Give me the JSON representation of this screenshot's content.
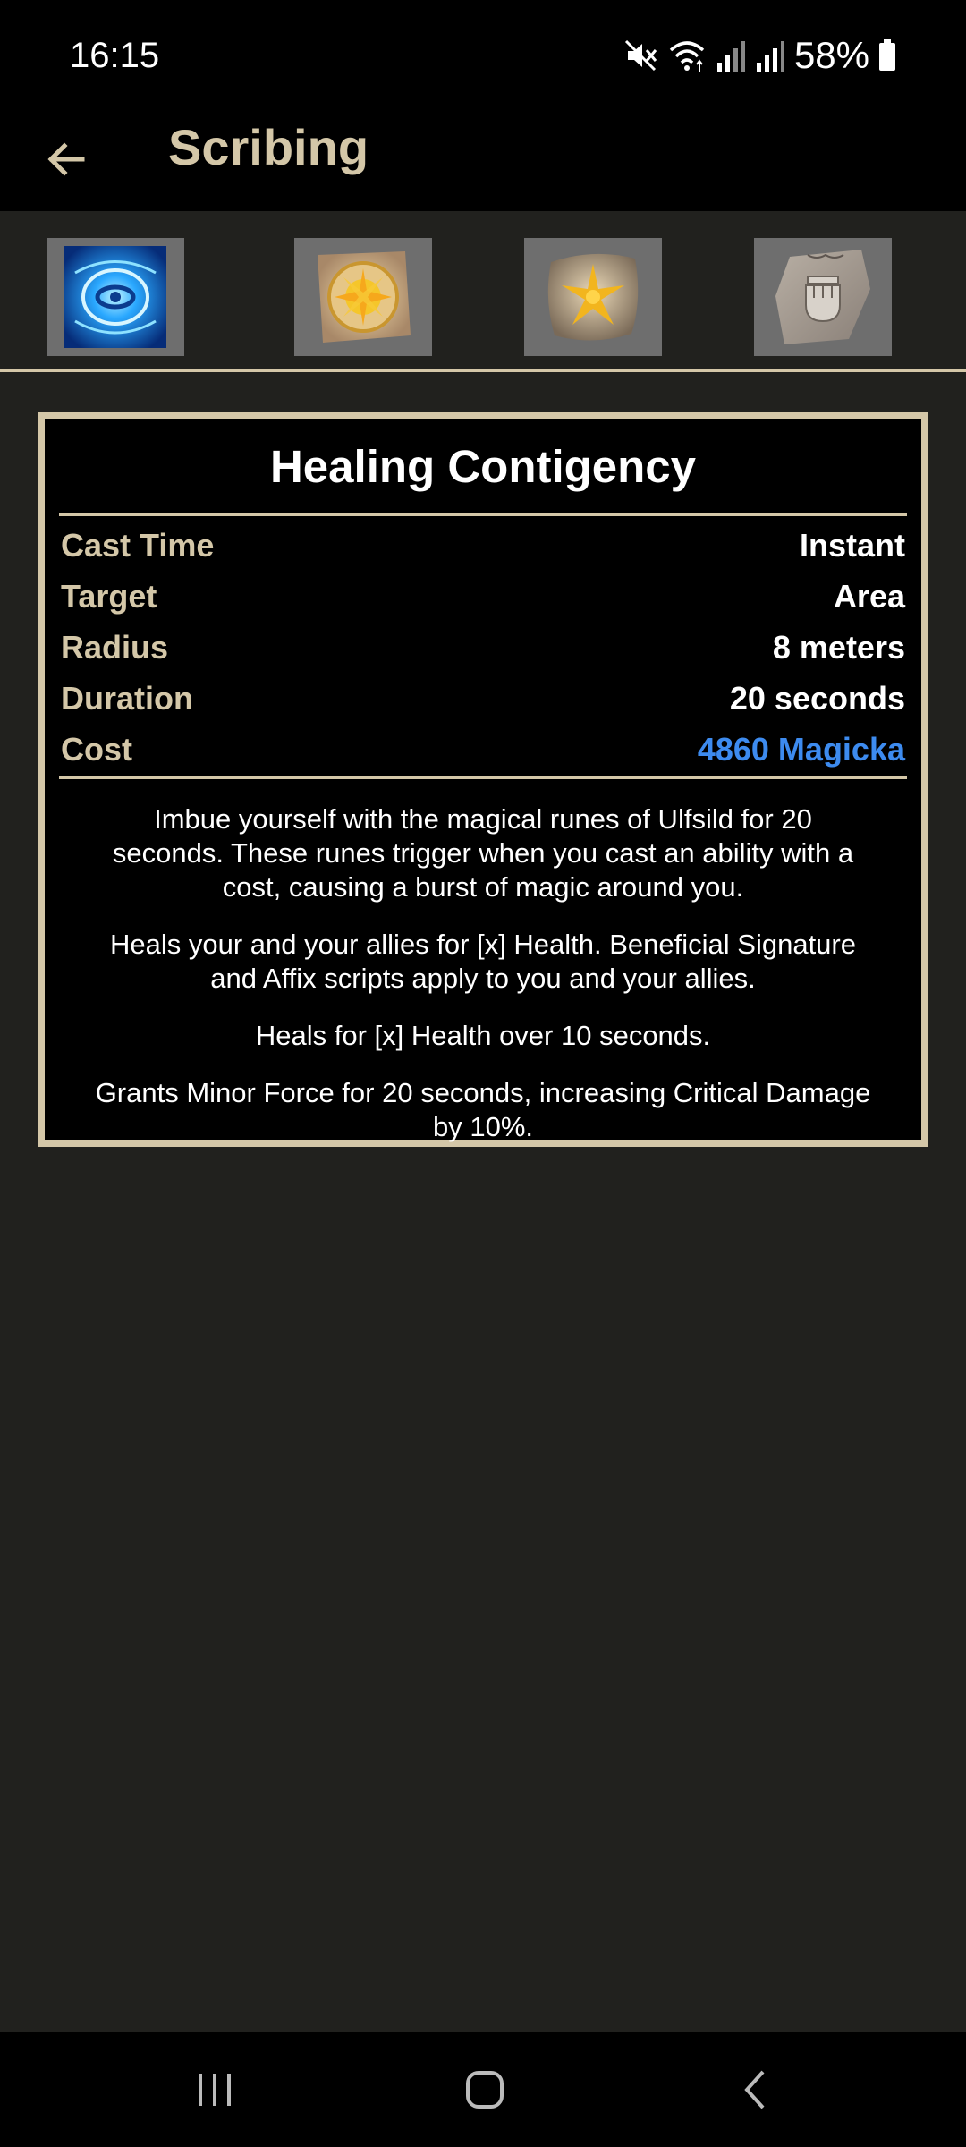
{
  "status": {
    "time": "16:15",
    "battery": "58%"
  },
  "appbar": {
    "title": "Scribing"
  },
  "tabs": [
    {
      "icon": "blue-magic-rune-icon"
    },
    {
      "icon": "sun-rune-stone-icon"
    },
    {
      "icon": "golden-star-stone-icon"
    },
    {
      "icon": "fist-stone-icon"
    }
  ],
  "card": {
    "title": "Healing Contigency",
    "stats": [
      {
        "label": "Cast Time",
        "value": "Instant"
      },
      {
        "label": "Target",
        "value": "Area"
      },
      {
        "label": "Radius",
        "value": "8 meters"
      },
      {
        "label": "Duration",
        "value": "20 seconds"
      },
      {
        "label": "Cost",
        "value": "4860 Magicka"
      }
    ],
    "descriptions": [
      "Imbue yourself with the magical runes of Ulfsild for 20 seconds. These runes trigger when you cast an ability with a cost, causing a burst of magic around you.",
      "Heals your and your allies for [x] Health. Beneficial Signature and Affix scripts apply to you and your allies.",
      "Heals for [x] Health over 10 seconds.",
      "Grants Minor Force for 20 seconds, increasing Critical Damage by 10%."
    ]
  },
  "colors": {
    "accent": "#d4c7a8",
    "magicka": "#3d8bef",
    "background": "#21211e"
  }
}
